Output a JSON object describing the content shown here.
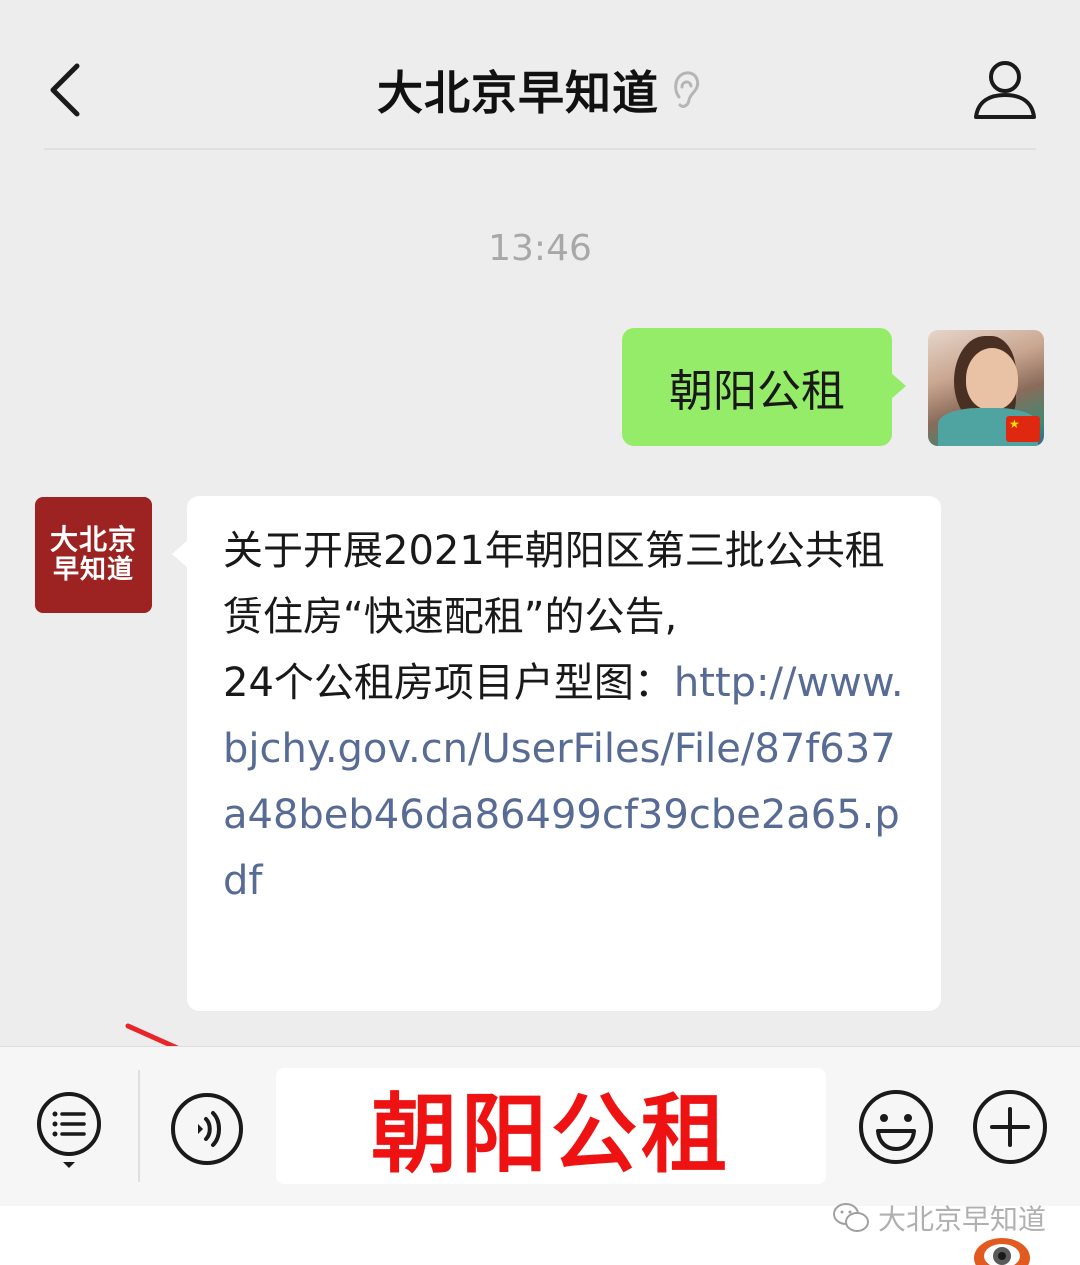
{
  "header": {
    "title": "大北京早知道",
    "back_icon": "chevron-left-icon",
    "ear_icon": "ear-icon",
    "profile_icon": "person-icon"
  },
  "chat": {
    "timestamp": "13:46",
    "outgoing_message": "朝阳公租",
    "official_avatar": {
      "line1": "大北京",
      "line2": "早知道",
      "color": "#9c2321"
    },
    "incoming_message": {
      "text": "关于开展2021年朝阳区第三批公共租赁住房“快速配租”的公告,",
      "text2": "24个公租房项目户型图：",
      "link": "http://www.bjchy.gov.cn/UserFiles/File/87f637a48beb46da86499cf39cbe2a65.pdf"
    }
  },
  "input_bar": {
    "menu_icon": "list-menu-icon",
    "voice_icon": "voice-icon",
    "input_value": "朝阳公租",
    "emoji_icon": "smiley-icon",
    "plus_icon": "plus-icon"
  },
  "watermark": {
    "text": "大北京早知道"
  },
  "colors": {
    "background": "#ededed",
    "outgoing_bubble": "#95ec69",
    "incoming_bubble": "#ffffff",
    "link": "#576b95",
    "input_text": "#ee1212",
    "annotation_arrow": "#e8262a"
  }
}
